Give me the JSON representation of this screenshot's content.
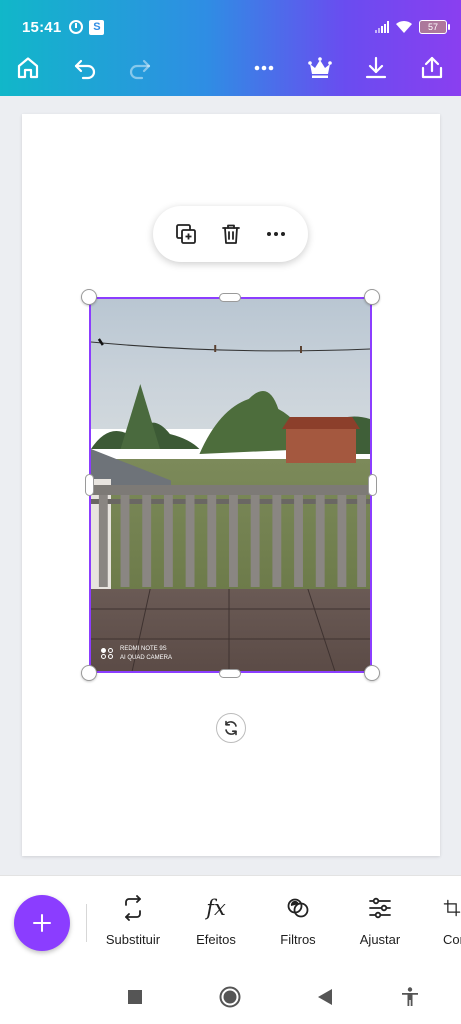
{
  "status_bar": {
    "time": "15:41",
    "notification_badge": "S",
    "battery": "57"
  },
  "toolbar": {
    "home_icon": "home-icon",
    "undo_icon": "undo-icon",
    "redo_icon": "redo-icon",
    "more_icon": "more-icon",
    "premium_icon": "crown-icon",
    "download_icon": "download-icon",
    "share_icon": "share-icon"
  },
  "context_menu": {
    "duplicate_icon": "duplicate-icon",
    "delete_icon": "trash-icon",
    "more_icon": "more-icon"
  },
  "photo": {
    "watermark_line1": "REDMI NOTE 9S",
    "watermark_line2": "AI QUAD CAMERA"
  },
  "bottom_tools": [
    {
      "label": "Substituir",
      "icon": "replace-icon"
    },
    {
      "label": "Efeitos",
      "icon": "fx-icon"
    },
    {
      "label": "Filtros",
      "icon": "filters-icon"
    },
    {
      "label": "Ajustar",
      "icon": "sliders-icon"
    },
    {
      "label": "Cor",
      "icon": "crop-icon"
    }
  ],
  "colors": {
    "accent": "#8b3dff",
    "header_gradient_start": "#11b7c9",
    "header_gradient_end": "#8a3ff0"
  }
}
